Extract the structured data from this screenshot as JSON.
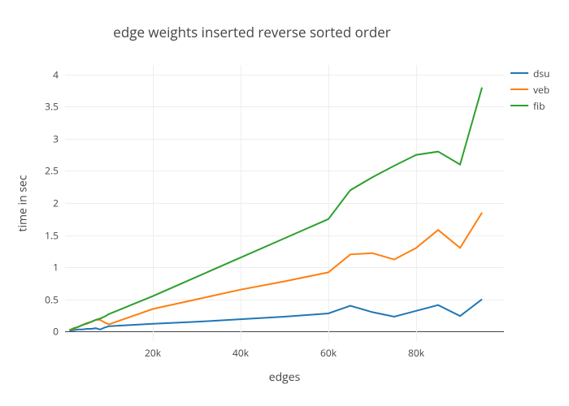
{
  "chart_data": {
    "type": "line",
    "title": "edge weights inserted reverse sorted order",
    "xlabel": "edges",
    "ylabel": "time in sec",
    "xlim": [
      0,
      100000
    ],
    "ylim": [
      -0.15,
      4.15
    ],
    "x_ticks": [
      20000,
      40000,
      60000,
      80000
    ],
    "x_tick_labels": [
      "20k",
      "40k",
      "60k",
      "80k"
    ],
    "y_ticks": [
      0,
      0.5,
      1,
      1.5,
      2,
      2.5,
      3,
      3.5,
      4
    ],
    "y_tick_labels": [
      "0",
      "0.5",
      "1",
      "1.5",
      "2",
      "2.5",
      "3",
      "3.5",
      "4"
    ],
    "x": [
      1000,
      2000,
      3000,
      4000,
      5000,
      6000,
      7000,
      8000,
      9000,
      10000,
      20000,
      30000,
      40000,
      50000,
      60000,
      65000,
      70000,
      75000,
      80000,
      85000,
      90000,
      95000
    ],
    "series": [
      {
        "name": "dsu",
        "color": "#1f77b4",
        "values": [
          0.01,
          0.02,
          0.03,
          0.03,
          0.04,
          0.04,
          0.05,
          0.03,
          0.06,
          0.08,
          0.12,
          0.15,
          0.19,
          0.23,
          0.28,
          0.4,
          0.3,
          0.23,
          0.32,
          0.41,
          0.24,
          0.5
        ]
      },
      {
        "name": "veb",
        "color": "#ff7f0e",
        "values": [
          0.02,
          0.04,
          0.07,
          0.1,
          0.12,
          0.15,
          0.18,
          0.18,
          0.14,
          0.11,
          0.35,
          0.5,
          0.65,
          0.78,
          0.92,
          1.2,
          1.22,
          1.12,
          1.3,
          1.58,
          1.3,
          1.85
        ]
      },
      {
        "name": "fib",
        "color": "#2ca02c",
        "values": [
          0.02,
          0.05,
          0.07,
          0.1,
          0.13,
          0.15,
          0.18,
          0.2,
          0.23,
          0.27,
          0.55,
          0.85,
          1.15,
          1.45,
          1.75,
          2.2,
          2.4,
          2.58,
          2.75,
          2.8,
          2.6,
          3.8
        ]
      }
    ]
  }
}
